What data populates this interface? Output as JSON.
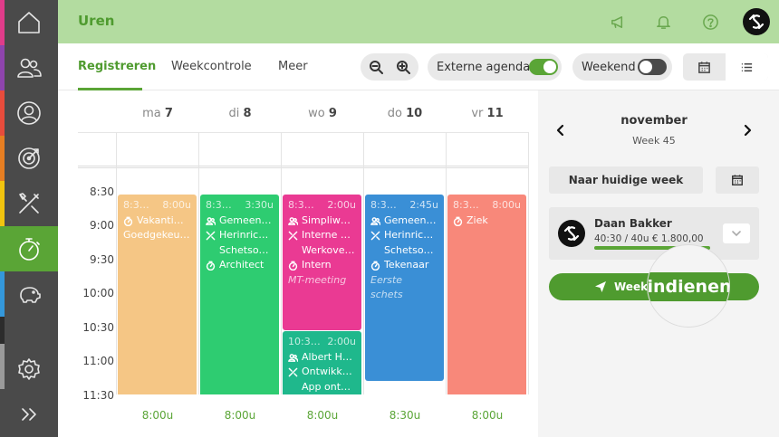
{
  "app": {
    "title": "Uren"
  },
  "tabs": [
    {
      "label": "Registreren",
      "active": true
    },
    {
      "label": "Weekcontrole",
      "active": false
    },
    {
      "label": "Meer",
      "active": false
    }
  ],
  "toolbar": {
    "external_agenda_label": "Externe agenda",
    "external_agenda_on": true,
    "weekend_label": "Weekend",
    "weekend_on": false
  },
  "days": [
    {
      "weekday": "ma",
      "date": "7",
      "total": "8:00u"
    },
    {
      "weekday": "di",
      "date": "8",
      "total": "8:00u"
    },
    {
      "weekday": "wo",
      "date": "9",
      "total": "8:00u"
    },
    {
      "weekday": "do",
      "date": "10",
      "total": "8:30u"
    },
    {
      "weekday": "vr",
      "date": "11",
      "total": "8:00u"
    }
  ],
  "times": [
    "8:30",
    "9:00",
    "9:30",
    "10:00",
    "10:30",
    "11:00",
    "11:30"
  ],
  "events": {
    "mon": {
      "start": "8:3…",
      "duration": "8:00u",
      "line1": "Vakanti…",
      "line2": "Goedgekeu…",
      "color": "#f5c685"
    },
    "tue": {
      "start": "8:3…",
      "duration": "3:30u",
      "line1": "Gemeen…",
      "line2": "Herinric…",
      "line3": "Schetso…",
      "line4": "Architect",
      "color": "#2ecc71"
    },
    "wed1": {
      "start": "8:3…",
      "duration": "2:00u",
      "line1": "Simpliw…",
      "line2": "Interne …",
      "line3": "Werkove…",
      "line4": "Intern",
      "note": "MT-meeting",
      "color": "#ea3a93"
    },
    "wed2": {
      "start": "10:3…",
      "duration": "2:00u",
      "line1": "Albert H…",
      "line2": "Ontwikk…",
      "line3": "App ont…",
      "color": "#1fb88c"
    },
    "thu": {
      "start": "8:3…",
      "duration": "2:45u",
      "line1": "Gemeen…",
      "line2": "Herinric…",
      "line3": "Schetso…",
      "line4": "Tekenaar",
      "note1": "Eerste",
      "note2": "schets",
      "color": "#3a8fd6"
    },
    "fri": {
      "start": "8:3…",
      "duration": "8:00u",
      "line1": "Ziek",
      "color": "#f8887a"
    }
  },
  "panel": {
    "month": "november",
    "week": "Week 45",
    "current_week_label": "Naar huidige week",
    "user_name": "Daan Bakker",
    "user_hours": "40:30 / 40u € 1.800,00",
    "progress": 1.0,
    "submit_label": "Week",
    "magnifier_text": "indienen"
  },
  "colors": {
    "accent": "#5aa536",
    "header_bg": "#b3dca0"
  }
}
